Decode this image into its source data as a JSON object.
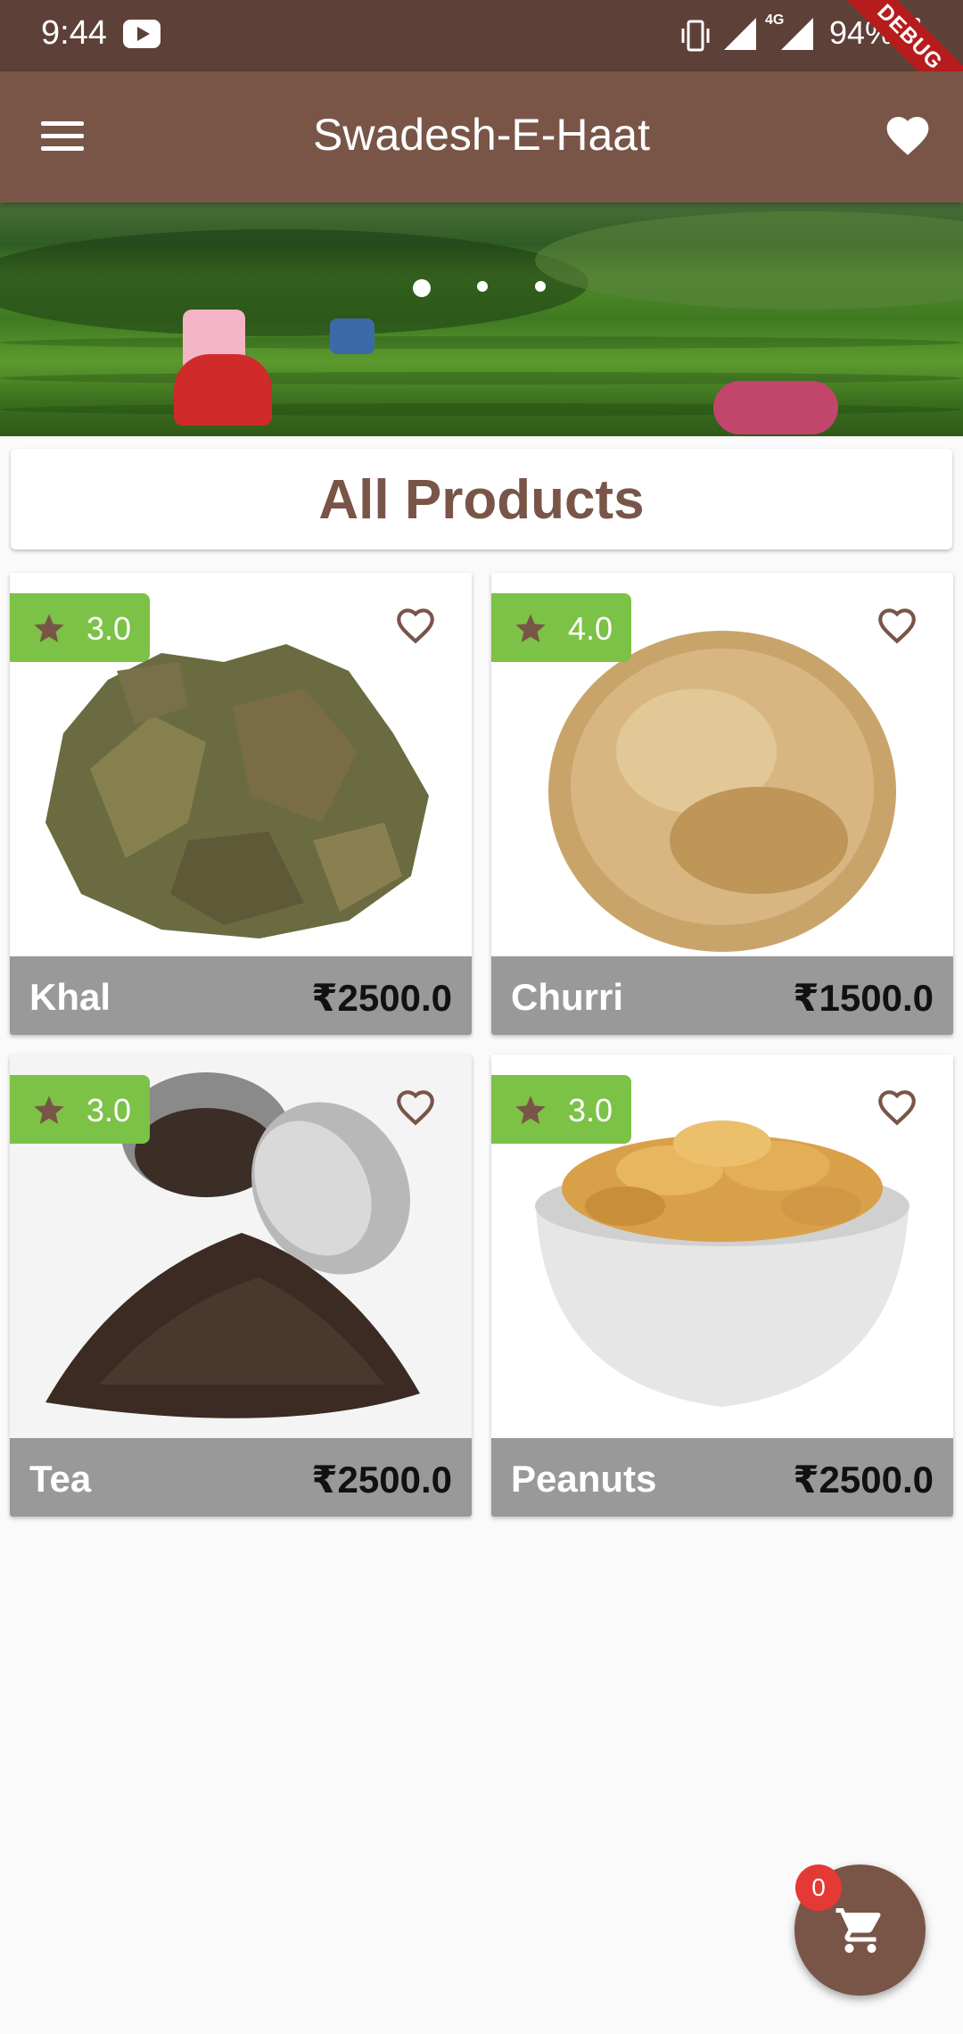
{
  "status_bar": {
    "time": "9:44",
    "network": "4G",
    "battery": "94%",
    "debug_label": "DEBUG"
  },
  "app_bar": {
    "title": "Swadesh-E-Haat",
    "menu_icon": "menu-icon",
    "favorites_icon": "heart-icon"
  },
  "banner": {
    "total_slides": 3,
    "active_slide": 1
  },
  "section": {
    "title": "All Products"
  },
  "products": [
    {
      "name": "Khal",
      "price": "₹2500.0",
      "rating": "3.0"
    },
    {
      "name": "Churri",
      "price": "₹1500.0",
      "rating": "4.0"
    },
    {
      "name": "Tea",
      "price": "₹2500.0",
      "rating": "3.0"
    },
    {
      "name": "Peanuts",
      "price": "₹2500.0",
      "rating": "3.0"
    }
  ],
  "cart": {
    "count": "0",
    "icon": "cart-icon"
  },
  "colors": {
    "primary": "#795548",
    "status_bar": "#5d4037",
    "rating_badge": "#7cc246",
    "cart_badge": "#e53935"
  }
}
